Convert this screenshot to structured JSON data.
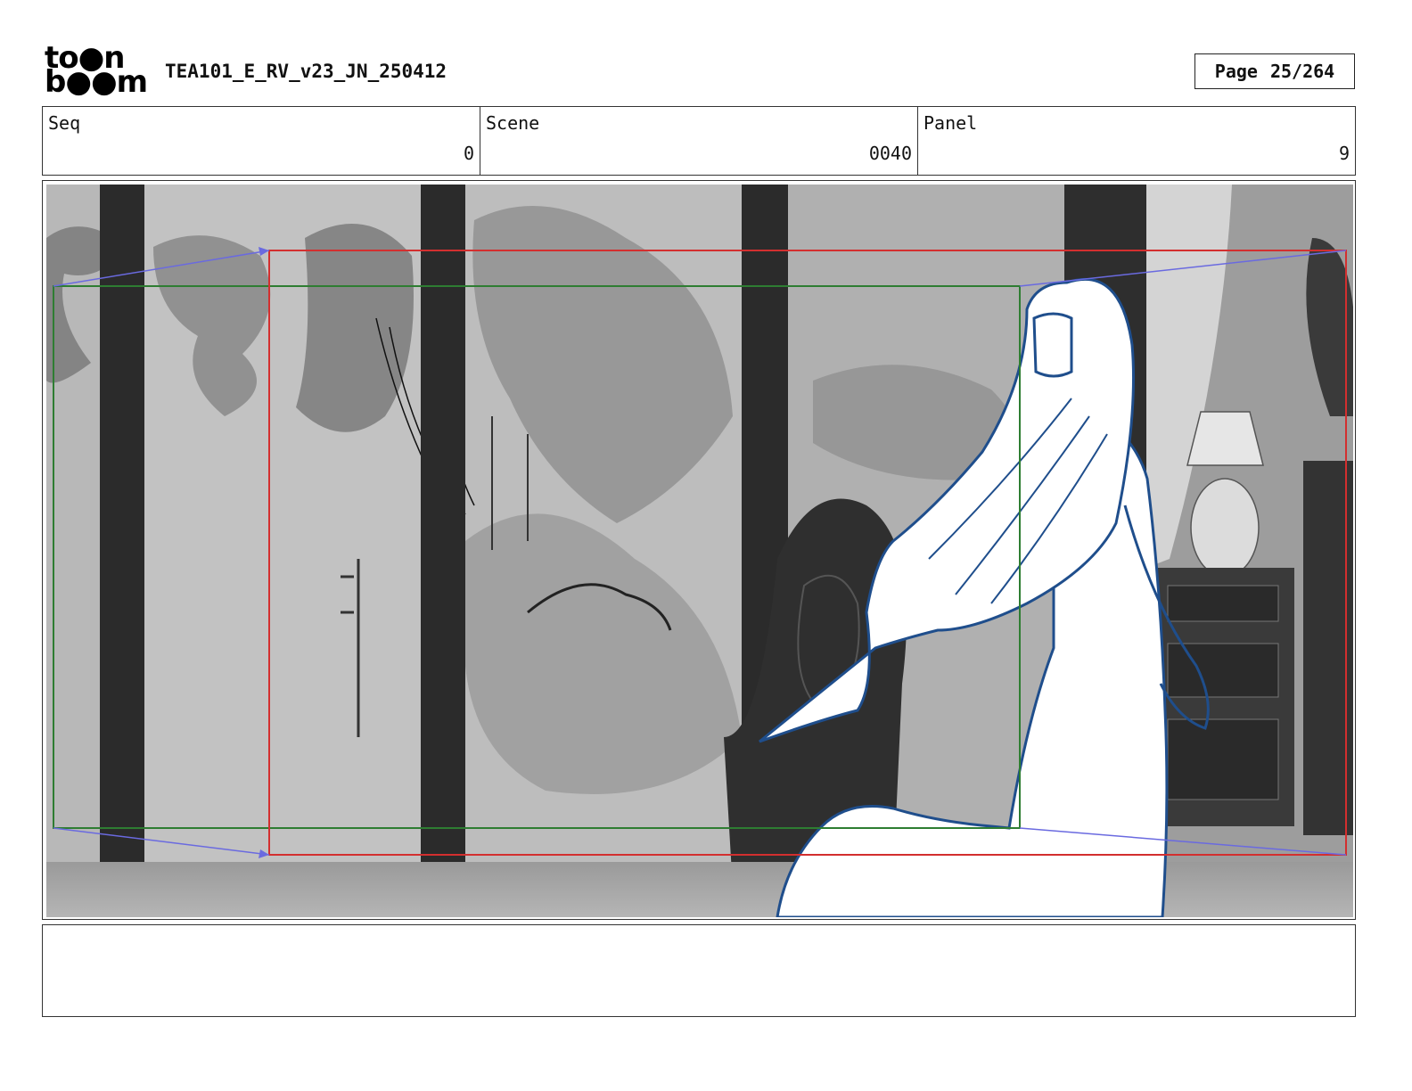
{
  "header": {
    "logo_line1": "to●n",
    "logo_line2": "b●●m",
    "document_title": "TEA101_E_RV_v23_JN_250412",
    "page_label": "Page",
    "page_value": "25/264"
  },
  "info": {
    "seq_label": "Seq",
    "seq_value": "0",
    "scene_label": "Scene",
    "scene_value": "0040",
    "panel_label": "Panel",
    "panel_value": "9"
  },
  "colors": {
    "camera_start_frame": "#2e7d32",
    "camera_end_frame": "#d32f2f",
    "camera_path": "#6a6ae0",
    "character_outline": "#1f4e8c"
  },
  "notes": {
    "text": ""
  }
}
